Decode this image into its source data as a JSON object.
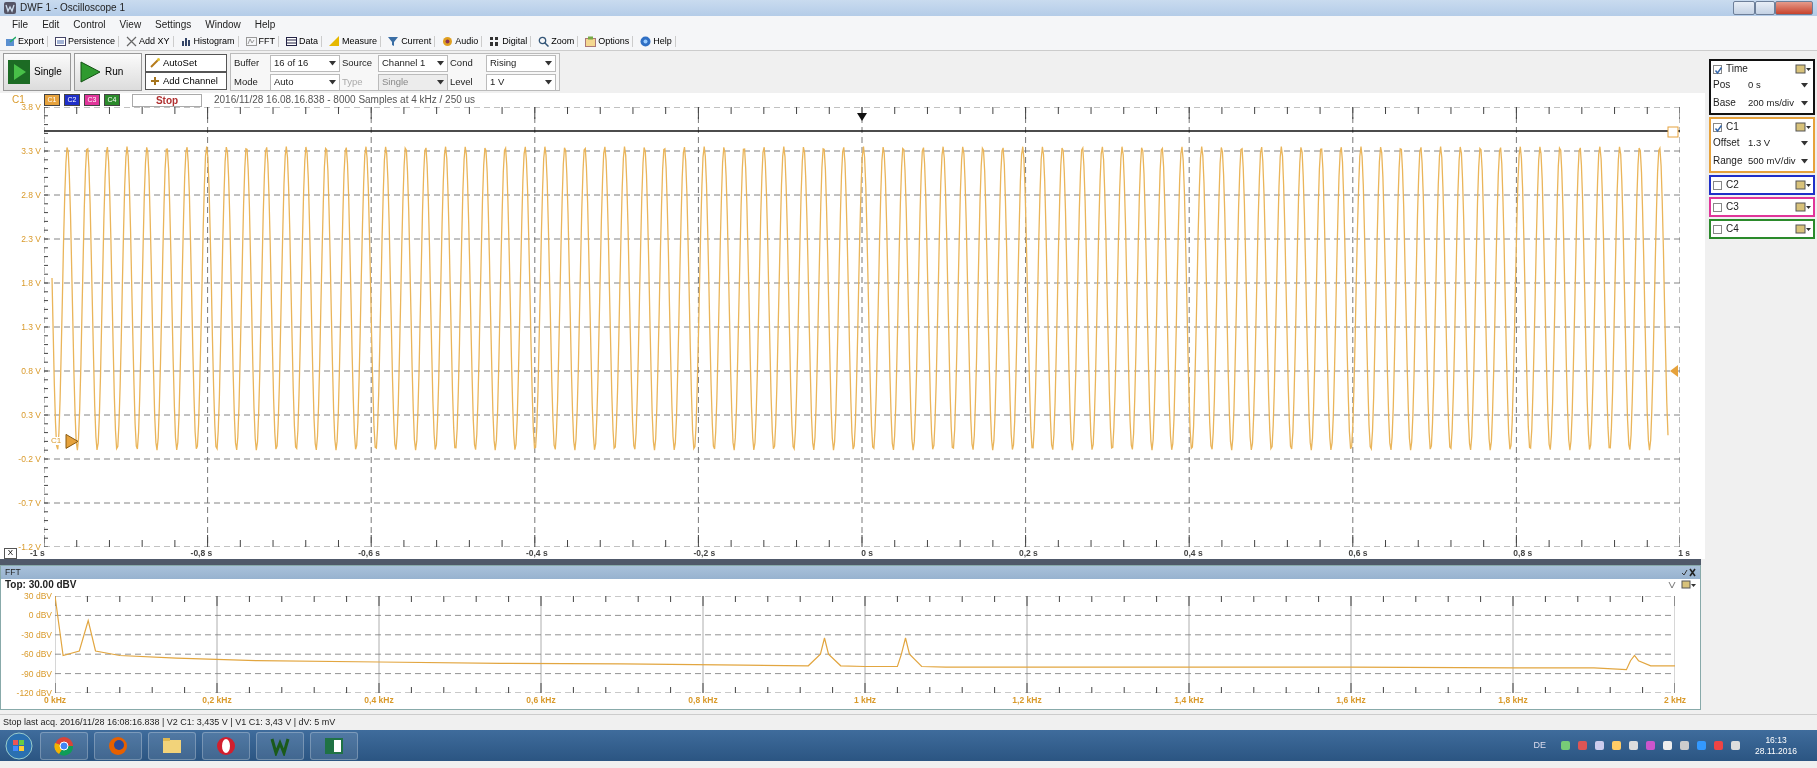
{
  "window": {
    "title": "DWF 1 - Oscilloscope 1"
  },
  "menu": [
    "File",
    "Edit",
    "Control",
    "View",
    "Settings",
    "Window",
    "Help"
  ],
  "toolbar": [
    "Export",
    "Persistence",
    "Add XY",
    "Histogram",
    "FFT",
    "Data",
    "Measure",
    "Current",
    "Audio",
    "Digital",
    "Zoom",
    "Options",
    "Help"
  ],
  "controls": {
    "single": "Single",
    "run": "Run",
    "autoset": "AutoSet",
    "add_channel": "Add Channel",
    "fields": [
      {
        "label": "Buffer",
        "value": "16 of 16",
        "disabled": false
      },
      {
        "label": "Mode",
        "value": "Auto",
        "disabled": false
      },
      {
        "label": "Source",
        "value": "Channel 1",
        "disabled": false
      },
      {
        "label": "Type",
        "value": "Single",
        "disabled": true
      },
      {
        "label": "Cond",
        "value": "Rising",
        "disabled": false
      },
      {
        "label": "Level",
        "value": "1 V",
        "disabled": false
      }
    ]
  },
  "plot": {
    "channel_label": "C1",
    "channel_buttons": [
      {
        "label": "C1",
        "color": "#e6a23c"
      },
      {
        "label": "C2",
        "color": "#1f2fc8"
      },
      {
        "label": "C3",
        "color": "#e0359a"
      },
      {
        "label": "C4",
        "color": "#2b8a2b"
      }
    ],
    "stop": "Stop",
    "info": "2016/11/28 16.08.16.838 - 8000 Samples at 4 kHz / 250 us",
    "y_labels": [
      "3.8 V",
      "3.3 V",
      "2.8 V",
      "2.3 V",
      "1.8 V",
      "1.3 V",
      "0.8 V",
      "0.3 V",
      "-0.2 V",
      "-0.7 V",
      "-1.2 V"
    ],
    "x_labels": [
      "-1 s",
      "-0,8 s",
      "-0,6 s",
      "-0,4 s",
      "-0,2 s",
      "0 s",
      "0,2 s",
      "0,4 s",
      "0,6 s",
      "0,8 s",
      "1 s"
    ],
    "marker_label": "C1",
    "x_button": "X"
  },
  "panel": [
    {
      "title": "Time",
      "checked": true,
      "color": "#111111",
      "rows": [
        {
          "label": "Pos",
          "value": "0 s"
        },
        {
          "label": "Base",
          "value": "200 ms/div"
        }
      ]
    },
    {
      "title": "C1",
      "checked": true,
      "color": "#e6a23c",
      "rows": [
        {
          "label": "Offset",
          "value": "1.3 V"
        },
        {
          "label": "Range",
          "value": "500 mV/div"
        }
      ]
    },
    {
      "title": "C2",
      "checked": false,
      "color": "#1f2fc8"
    },
    {
      "title": "C3",
      "checked": false,
      "color": "#e0359a"
    },
    {
      "title": "C4",
      "checked": false,
      "color": "#2b8a2b"
    }
  ],
  "fft": {
    "title": "FFT",
    "top": "Top: 30.00 dBV",
    "chart_data": {
      "type": "line",
      "grid": true,
      "xlim": [
        0,
        2
      ],
      "ylim": [
        -120,
        30
      ],
      "x": [
        0,
        0.01,
        0.03,
        0.041,
        0.05,
        0.08,
        0.15,
        0.25,
        0.4,
        0.55,
        0.7,
        0.85,
        0.93,
        0.945,
        0.95,
        0.955,
        0.97,
        1.0,
        1.04,
        1.045,
        1.05,
        1.055,
        1.07,
        1.1,
        1.2,
        1.4,
        1.6,
        1.8,
        1.9,
        1.94,
        1.945,
        1.95,
        1.955,
        1.97,
        2.0
      ],
      "series": [
        {
          "color": "#e2a640",
          "values": [
            30,
            -62,
            -55,
            -8,
            -55,
            -62,
            -66,
            -70,
            -72,
            -74,
            -75,
            -77,
            -78,
            -60,
            -35,
            -60,
            -78,
            -79,
            -79,
            -60,
            -35,
            -60,
            -79,
            -80,
            -80,
            -80,
            -80,
            -81,
            -81,
            -84,
            -70,
            -62,
            -70,
            -78,
            -78
          ]
        }
      ],
      "yticks": [
        {
          "value": 30,
          "label": "30 dBV"
        },
        {
          "value": 0,
          "label": "0 dBV"
        },
        {
          "value": -30,
          "label": "-30 dBV"
        },
        {
          "value": -60,
          "label": "-60 dBV"
        },
        {
          "value": -90,
          "label": "-90 dBV"
        },
        {
          "value": -120,
          "label": "-120 dBV"
        }
      ],
      "xticks": [
        {
          "value": 0,
          "label": "0 kHz"
        },
        {
          "value": 0.2,
          "label": "0,2 kHz"
        },
        {
          "value": 0.4,
          "label": "0,4 kHz"
        },
        {
          "value": 0.6,
          "label": "0,6 kHz"
        },
        {
          "value": 0.8,
          "label": "0,8 kHz"
        },
        {
          "value": 1,
          "label": "1 kHz"
        },
        {
          "value": 1.2,
          "label": "1,2 kHz"
        },
        {
          "value": 1.4,
          "label": "1,4 kHz"
        },
        {
          "value": 1.6,
          "label": "1,6 kHz"
        },
        {
          "value": 1.8,
          "label": "1,8 kHz"
        },
        {
          "value": 2,
          "label": "2 kHz"
        }
      ]
    }
  },
  "status_bar": "Stop last acq. 2016/11/28 16:08:16.838 | V2 C1: 3,435 V | V1 C1: 3,43 V | dV: 5 mV",
  "taskbar": {
    "language": "DE",
    "time": "16:13",
    "date": "28.11.2016"
  }
}
